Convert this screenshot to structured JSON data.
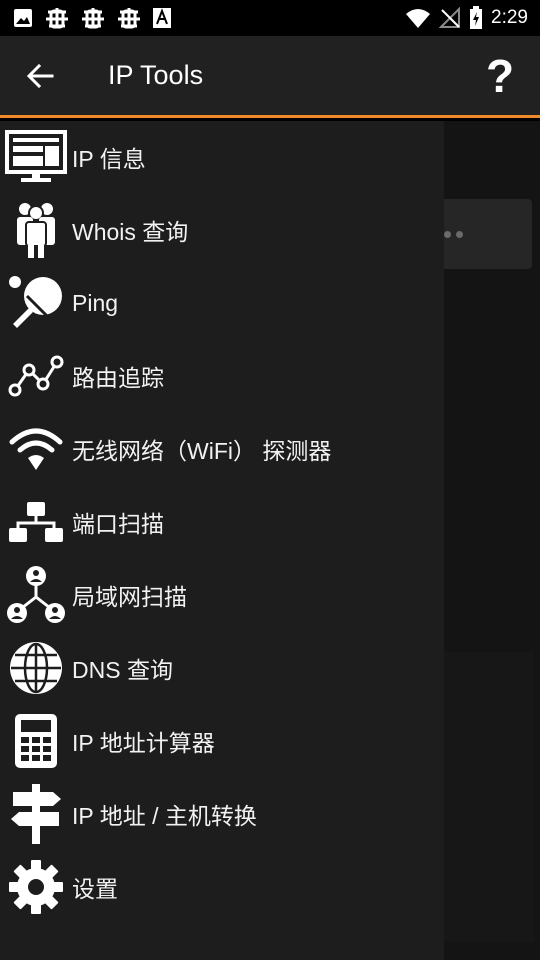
{
  "status_bar": {
    "time": "2:29",
    "left_icons": [
      "image-icon",
      "bug-icon",
      "bug-icon",
      "bug-icon",
      "font-a-icon"
    ],
    "right_icons": [
      "wifi-icon",
      "no-signal-icon",
      "battery-charging-icon"
    ]
  },
  "app_bar": {
    "title": "IP Tools",
    "help_label": "?"
  },
  "drawer": {
    "items": [
      {
        "label": "IP 信息",
        "icon": "monitor-icon"
      },
      {
        "label": "Whois 查询",
        "icon": "people-icon"
      },
      {
        "label": "Ping",
        "icon": "ping-pong-icon"
      },
      {
        "label": "路由追踪",
        "icon": "route-icon"
      },
      {
        "label": "无线网络（WiFi） 探测器",
        "icon": "wifi-icon"
      },
      {
        "label": "端口扫描",
        "icon": "network-tree-icon"
      },
      {
        "label": "局域网扫描",
        "icon": "lan-users-icon"
      },
      {
        "label": "DNS 查询",
        "icon": "globe-icon"
      },
      {
        "label": "IP 地址计算器",
        "icon": "calculator-icon"
      },
      {
        "label": "IP 地址 / 主机转换",
        "icon": "signpost-icon"
      },
      {
        "label": "设置",
        "icon": "gear-icon"
      }
    ]
  },
  "colors": {
    "accent": "#ef8a2b",
    "app_bar": "#212121",
    "drawer": "#1d1d1d"
  }
}
